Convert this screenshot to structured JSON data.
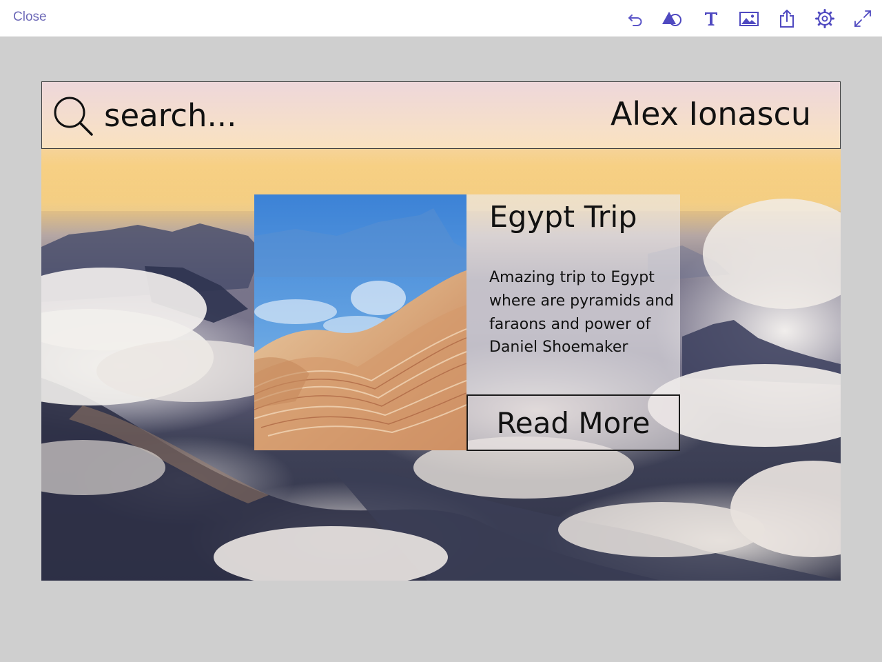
{
  "toolbar": {
    "close_label": "Close",
    "icons": [
      "undo-icon",
      "shapes-icon",
      "text-icon",
      "image-icon",
      "share-icon",
      "settings-icon",
      "expand-icon"
    ],
    "icon_color": "#5b55c8"
  },
  "artboard": {
    "header": {
      "search_placeholder": "search...",
      "user_name": "Alex Ionascu"
    },
    "card": {
      "title": "Egypt Trip",
      "description": "Amazing trip to  Egypt where are pyramids and faraons and power of Daniel Shoemaker",
      "button_label": "Read More"
    }
  },
  "colors": {
    "canvas_background": "#cfcfcf",
    "close_text": "#6e6ab8",
    "text": "#111111"
  }
}
